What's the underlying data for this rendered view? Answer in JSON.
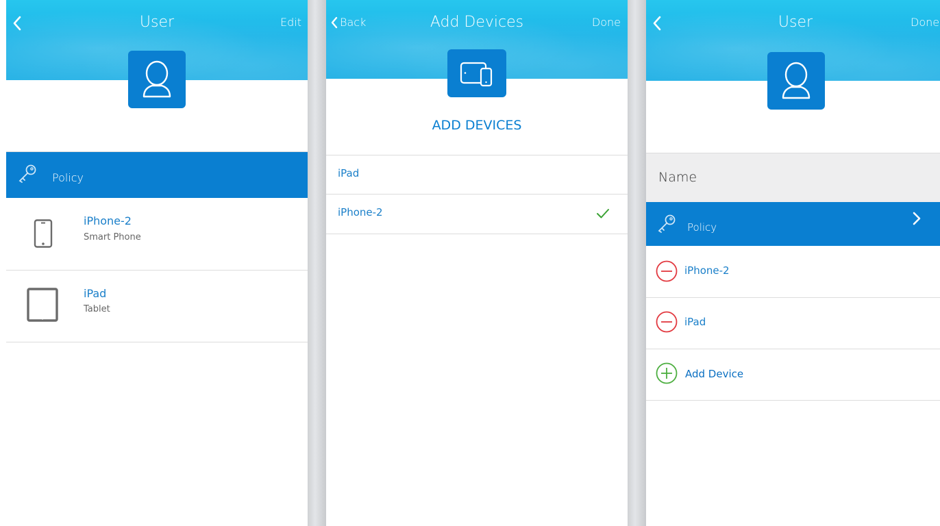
{
  "screen1": {
    "title": "User",
    "edit_label": "Edit",
    "policy_label": "Policy",
    "devices": [
      {
        "name": "iPhone-2",
        "type": "Smart Phone",
        "icon": "smartphone-icon"
      },
      {
        "name": "iPad",
        "type": "Tablet",
        "icon": "tablet-icon"
      }
    ]
  },
  "screen2": {
    "back_label": "Back",
    "title": "Add Devices",
    "done_label": "Done",
    "section_heading": "ADD DEVICES",
    "items": [
      {
        "name": "iPad",
        "checked": false
      },
      {
        "name": "iPhone-2",
        "checked": true
      }
    ]
  },
  "screen3": {
    "title": "User",
    "done_label": "Done",
    "name_label": "Name",
    "policy_label": "Policy",
    "devices": [
      {
        "name": "iPhone-2",
        "icon": "remove-circle-icon"
      },
      {
        "name": "iPad",
        "icon": "remove-circle-icon"
      }
    ],
    "add_device_label": "Add Device"
  },
  "colors": {
    "header_blue": "#1cb5e8",
    "accent_blue": "#0a7fd1",
    "link_blue": "#1a7fc9",
    "remove_red": "#e2383f",
    "add_green": "#4cae3f",
    "check_green": "#3aa233"
  }
}
